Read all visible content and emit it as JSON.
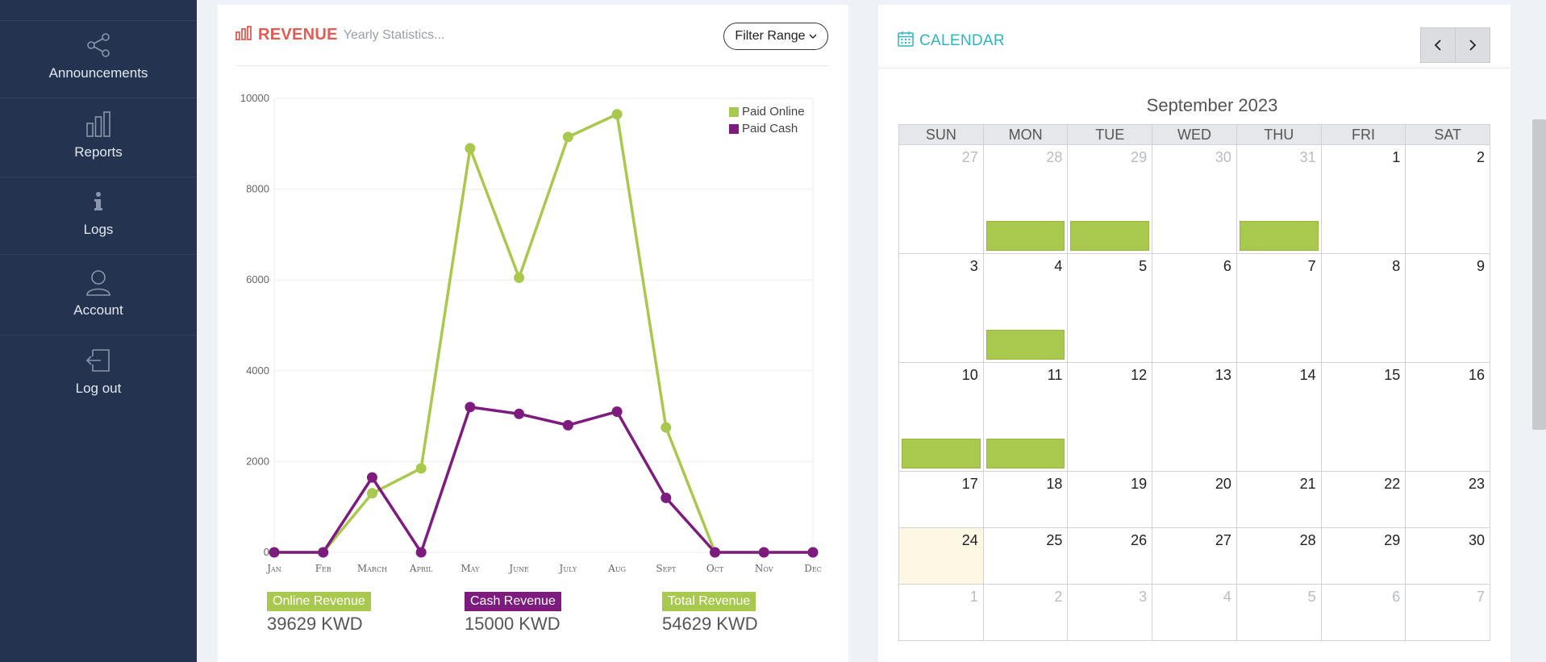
{
  "sidebar": {
    "items": [
      {
        "label": "Announcements",
        "icon": "share-icon"
      },
      {
        "label": "Reports",
        "icon": "bar-chart-icon"
      },
      {
        "label": "Logs",
        "icon": "info-icon"
      },
      {
        "label": "Account",
        "icon": "user-icon"
      },
      {
        "label": "Log out",
        "icon": "logout-icon"
      }
    ]
  },
  "revenue": {
    "title": "REVENUE",
    "subtitle": "Yearly Statistics...",
    "filter_label": "Filter Range",
    "totals": [
      {
        "label": "Online Revenue",
        "value": "39629 KWD",
        "color": "#a9c94e"
      },
      {
        "label": "Cash Revenue",
        "value": "15000 KWD",
        "color": "#7d1b7f"
      },
      {
        "label": "Total Revenue",
        "value": "54629 KWD",
        "color": "#a9c94e"
      }
    ]
  },
  "chart_data": {
    "type": "line",
    "categories": [
      "Jan",
      "Feb",
      "March",
      "April",
      "May",
      "June",
      "July",
      "Aug",
      "Sept",
      "Oct",
      "Nov",
      "Dec"
    ],
    "series": [
      {
        "name": "Paid Online",
        "color": "#a9c94e",
        "values": [
          0,
          0,
          1300,
          1850,
          8900,
          6050,
          9150,
          9650,
          2750,
          0,
          0,
          0
        ]
      },
      {
        "name": "Paid Cash",
        "color": "#7d1b7f",
        "values": [
          0,
          0,
          1650,
          0,
          3200,
          3050,
          2800,
          3100,
          1200,
          0,
          0,
          0
        ]
      }
    ],
    "yticks": [
      "0",
      "2000",
      "4000",
      "6000",
      "8000",
      "10000"
    ],
    "ylim": [
      0,
      10000
    ],
    "grid": true,
    "legend": "top-right"
  },
  "calendar": {
    "title": "CALENDAR",
    "month": "September 2023",
    "weekdays": [
      "SUN",
      "MON",
      "TUE",
      "WED",
      "THU",
      "FRI",
      "SAT"
    ],
    "weeks": [
      [
        {
          "d": "27",
          "o": true
        },
        {
          "d": "28",
          "o": true,
          "e": true
        },
        {
          "d": "29",
          "o": true,
          "e": true
        },
        {
          "d": "30",
          "o": true
        },
        {
          "d": "31",
          "o": true,
          "e": true
        },
        {
          "d": "1"
        },
        {
          "d": "2"
        }
      ],
      [
        {
          "d": "3"
        },
        {
          "d": "4",
          "e": true
        },
        {
          "d": "5"
        },
        {
          "d": "6"
        },
        {
          "d": "7"
        },
        {
          "d": "8"
        },
        {
          "d": "9"
        }
      ],
      [
        {
          "d": "10",
          "e": true
        },
        {
          "d": "11",
          "e": true
        },
        {
          "d": "12"
        },
        {
          "d": "13"
        },
        {
          "d": "14"
        },
        {
          "d": "15"
        },
        {
          "d": "16"
        }
      ],
      [
        {
          "d": "17"
        },
        {
          "d": "18"
        },
        {
          "d": "19"
        },
        {
          "d": "20"
        },
        {
          "d": "21"
        },
        {
          "d": "22"
        },
        {
          "d": "23"
        }
      ],
      [
        {
          "d": "24",
          "t": true
        },
        {
          "d": "25"
        },
        {
          "d": "26"
        },
        {
          "d": "27"
        },
        {
          "d": "28"
        },
        {
          "d": "29"
        },
        {
          "d": "30"
        }
      ],
      [
        {
          "d": "1",
          "o": true
        },
        {
          "d": "2",
          "o": true
        },
        {
          "d": "3",
          "o": true
        },
        {
          "d": "4",
          "o": true
        },
        {
          "d": "5",
          "o": true
        },
        {
          "d": "6",
          "o": true
        },
        {
          "d": "7",
          "o": true
        }
      ]
    ]
  }
}
